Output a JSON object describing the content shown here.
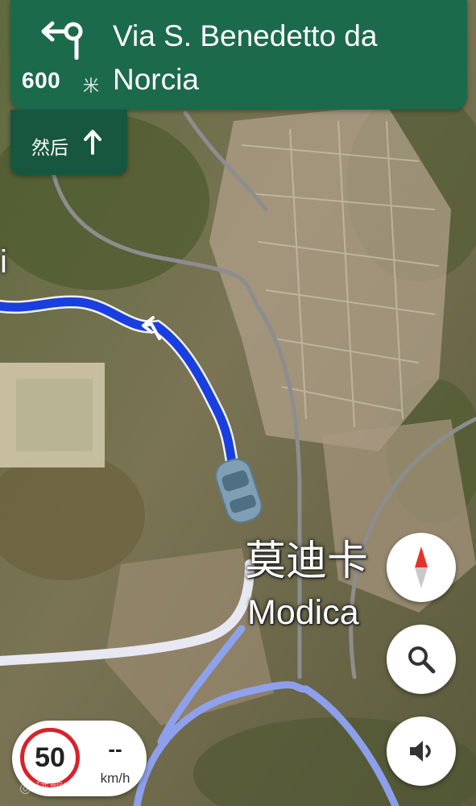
{
  "header": {
    "distance_value": "600",
    "distance_unit": "米",
    "street_name": "Via S. Benedetto da Norcia",
    "turn_icon": "turn-left-then-right-arrow-icon",
    "background_color": "#1c6a4c"
  },
  "then_instruction": {
    "label": "然后",
    "icon": "arrow-up-icon"
  },
  "map": {
    "place_name_zh": "莫迪卡",
    "place_name_en": "Modica",
    "partial_label_left": "i",
    "route_color": "#1a3fe0",
    "imagery": "satellite"
  },
  "controls": {
    "compass_icon": "compass-icon",
    "search_icon": "search-icon",
    "sound_icon": "volume-icon"
  },
  "speed": {
    "limit": "50",
    "current": "--",
    "unit": "km/h"
  },
  "watermark": "◎ 碰鹅车"
}
